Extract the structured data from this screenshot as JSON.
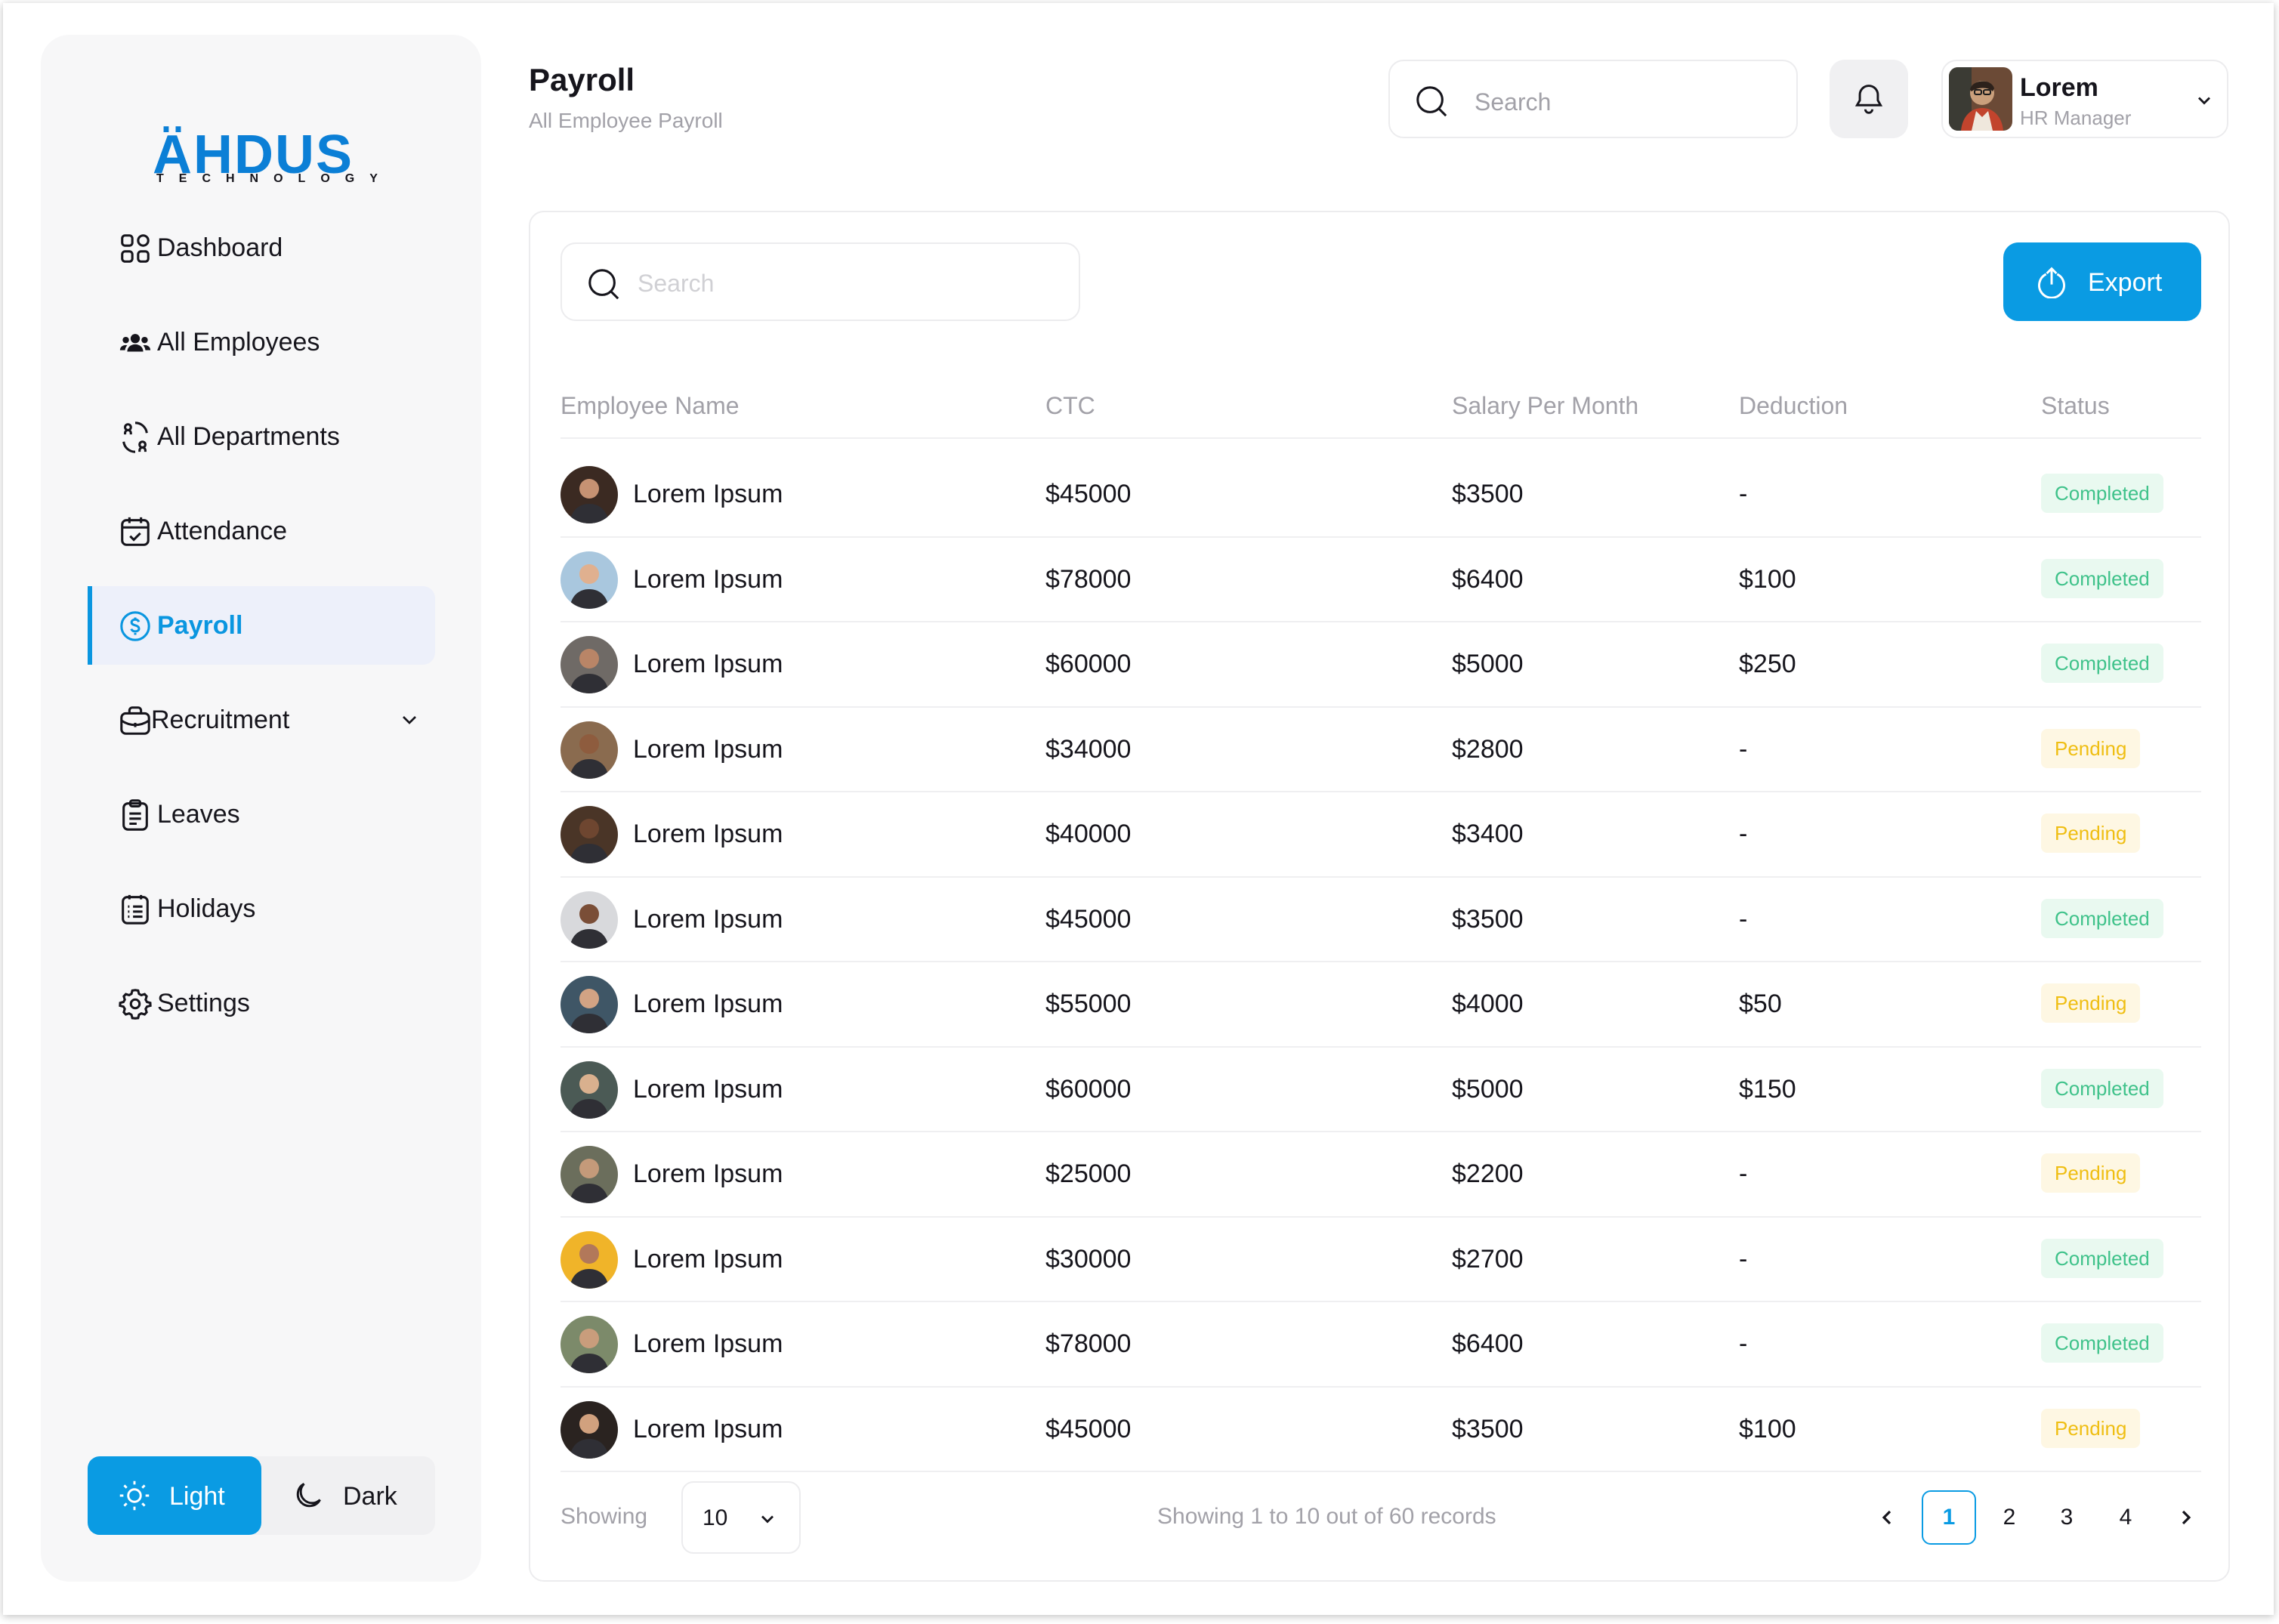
{
  "brand": {
    "name": "ÄHDUS",
    "tagline": "TECHNOLOGY"
  },
  "sidebar": {
    "items": [
      {
        "label": "Dashboard",
        "icon": "dashboard-grid-icon"
      },
      {
        "label": "All Employees",
        "icon": "users-icon"
      },
      {
        "label": "All Departments",
        "icon": "departments-icon"
      },
      {
        "label": "Attendance",
        "icon": "calendar-check-icon"
      },
      {
        "label": "Payroll",
        "icon": "dollar-circle-icon",
        "active": true
      },
      {
        "label": "Recruitment",
        "icon": "briefcase-icon",
        "has_submenu": true
      },
      {
        "label": "Leaves",
        "icon": "clipboard-icon"
      },
      {
        "label": "Holidays",
        "icon": "calendar-list-icon"
      },
      {
        "label": "Settings",
        "icon": "gear-icon"
      }
    ],
    "theme": {
      "light_label": "Light",
      "dark_label": "Dark",
      "selected": "Light"
    }
  },
  "header": {
    "title": "Payroll",
    "subtitle": "All Employee Payroll",
    "search_placeholder": "Search",
    "user": {
      "name": "Lorem",
      "role": "HR Manager"
    }
  },
  "table": {
    "search_placeholder": "Search",
    "export_label": "Export",
    "columns": [
      "Employee Name",
      "CTC",
      "Salary Per Month",
      "Deduction",
      "Status"
    ],
    "rows": [
      {
        "name": "Lorem Ipsum",
        "ctc": "$45000",
        "salary": "$3500",
        "deduction": "-",
        "status": "Completed"
      },
      {
        "name": "Lorem Ipsum",
        "ctc": "$78000",
        "salary": "$6400",
        "deduction": "$100",
        "status": "Completed"
      },
      {
        "name": "Lorem Ipsum",
        "ctc": "$60000",
        "salary": "$5000",
        "deduction": "$250",
        "status": "Completed"
      },
      {
        "name": "Lorem Ipsum",
        "ctc": "$34000",
        "salary": "$2800",
        "deduction": "-",
        "status": "Pending"
      },
      {
        "name": "Lorem Ipsum",
        "ctc": "$40000",
        "salary": "$3400",
        "deduction": "-",
        "status": "Pending"
      },
      {
        "name": "Lorem Ipsum",
        "ctc": "$45000",
        "salary": "$3500",
        "deduction": "-",
        "status": "Completed"
      },
      {
        "name": "Lorem Ipsum",
        "ctc": "$55000",
        "salary": "$4000",
        "deduction": "$50",
        "status": "Pending"
      },
      {
        "name": "Lorem Ipsum",
        "ctc": "$60000",
        "salary": "$5000",
        "deduction": "$150",
        "status": "Completed"
      },
      {
        "name": "Lorem Ipsum",
        "ctc": "$25000",
        "salary": "$2200",
        "deduction": "-",
        "status": "Pending"
      },
      {
        "name": "Lorem Ipsum",
        "ctc": "$30000",
        "salary": "$2700",
        "deduction": "-",
        "status": "Completed"
      },
      {
        "name": "Lorem Ipsum",
        "ctc": "$78000",
        "salary": "$6400",
        "deduction": "-",
        "status": "Completed"
      },
      {
        "name": "Lorem Ipsum",
        "ctc": "$45000",
        "salary": "$3500",
        "deduction": "$100",
        "status": "Pending"
      }
    ],
    "avatar_colors": [
      "#3b2a22",
      "#a9c7de",
      "#6f6a66",
      "#8a6b4f",
      "#4a3527",
      "#d8d9dc",
      "#3f5666",
      "#4b5a55",
      "#6b6e5c",
      "#f0b429",
      "#7c8a6a",
      "#2a2320"
    ]
  },
  "footer": {
    "showing_label": "Showing",
    "page_size": "10",
    "records_info": "Showing 1 to 10 out of 60 records",
    "pages": [
      "1",
      "2",
      "3",
      "4"
    ],
    "current_page": "1"
  },
  "colors": {
    "accent": "#0a9be3",
    "completed_text": "#3fc28a",
    "completed_bg": "#e9f9f0",
    "pending_text": "#efbe12",
    "pending_bg": "#fef7e3"
  }
}
